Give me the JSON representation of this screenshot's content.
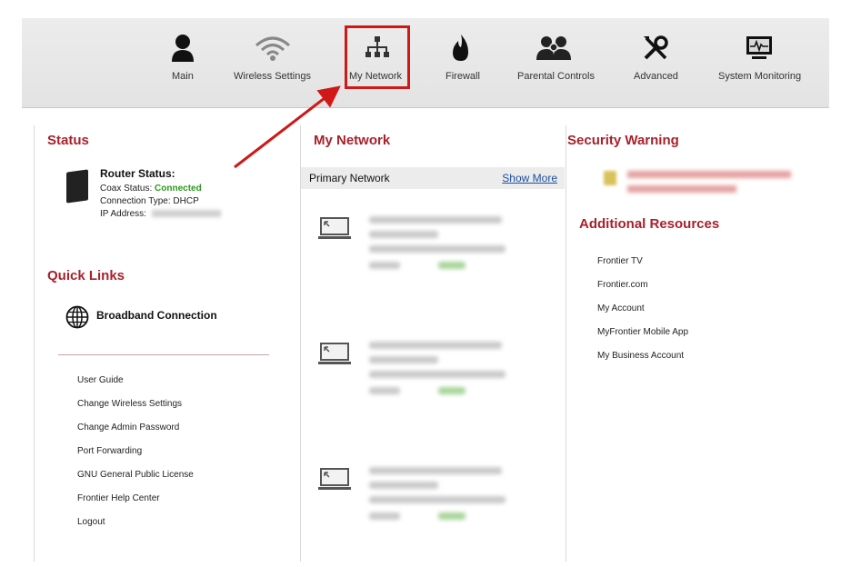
{
  "nav": {
    "items": [
      {
        "label": "Main",
        "icon": "user-icon"
      },
      {
        "label": "Wireless Settings",
        "icon": "wifi-icon"
      },
      {
        "label": "My Network",
        "icon": "network-icon",
        "highlighted": true
      },
      {
        "label": "Firewall",
        "icon": "flame-icon"
      },
      {
        "label": "Parental Controls",
        "icon": "users-icon"
      },
      {
        "label": "Advanced",
        "icon": "tools-icon"
      },
      {
        "label": "System Monitoring",
        "icon": "monitor-icon"
      }
    ]
  },
  "status": {
    "title": "Status",
    "router_title": "Router Status:",
    "coax_label": "Coax Status:",
    "coax_value": "Connected",
    "connection_type": "Connection Type: DHCP",
    "ip_label": "IP Address:"
  },
  "quick_links": {
    "title": "Quick Links",
    "broadband": "Broadband Connection",
    "links": [
      "User Guide",
      "Change Wireless Settings",
      "Change Admin Password",
      "Port Forwarding",
      "GNU General Public License",
      "Frontier Help Center",
      "Logout"
    ]
  },
  "my_network": {
    "title": "My Network",
    "primary_label": "Primary Network",
    "show_more": "Show More"
  },
  "security": {
    "title": "Security Warning"
  },
  "resources": {
    "title": "Additional Resources",
    "links": [
      "Frontier TV",
      "Frontier.com",
      "My Account",
      "MyFrontier Mobile App",
      "My Business Account"
    ]
  },
  "colors": {
    "accent": "#a8212b",
    "highlight": "#d01818",
    "connected": "#2b9a1e",
    "link": "#1b4ea0"
  }
}
